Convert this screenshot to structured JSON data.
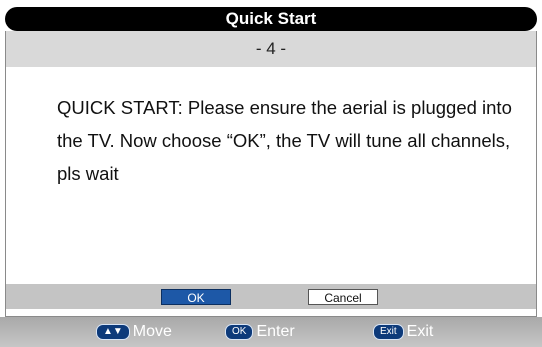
{
  "dialog": {
    "title": "Quick Start",
    "page_indicator": "- 4 -",
    "message": "QUICK START: Please ensure the aerial is plugged into the TV. Now choose “OK”, the TV will tune all channels, pls wait"
  },
  "buttons": {
    "ok_label": "OK",
    "cancel_label": "Cancel",
    "selected": "OK"
  },
  "footer": {
    "move": {
      "key": "▲▼",
      "label": "Move"
    },
    "enter": {
      "key": "OK",
      "label": "Enter"
    },
    "exit": {
      "key": "Exit",
      "label": "Exit"
    }
  },
  "colors": {
    "title_bar": "#000000",
    "selected_button": "#1d58a7",
    "key_pill": "#0d3a7a"
  }
}
